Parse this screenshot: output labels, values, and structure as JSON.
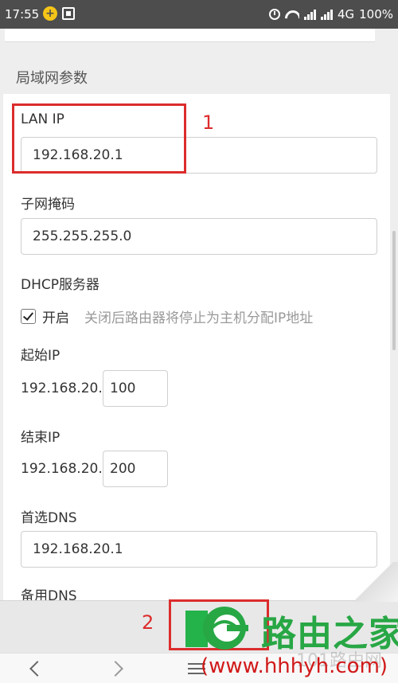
{
  "status_bar": {
    "time": "17:55",
    "network": "4G",
    "battery": "100%",
    "icons": [
      "app-plus-icon",
      "scan-icon",
      "alarm-icon",
      "wifi-icon",
      "signal-icon",
      "signal-icon",
      "battery-icon"
    ]
  },
  "lan": {
    "section_title": "局域网参数",
    "lan_ip_label": "LAN IP",
    "lan_ip_value": "192.168.20.1",
    "subnet_label": "子网掩码",
    "subnet_value": "255.255.255.0",
    "dhcp_label": "DHCP服务器",
    "dhcp_enable_label": "开启",
    "dhcp_enabled": true,
    "dhcp_hint": "关闭后路由器将停止为主机分配IP地址",
    "start_ip_label": "起始IP",
    "ip_prefix": "192.168.20.",
    "start_ip_value": "100",
    "end_ip_label": "结束IP",
    "end_ip_value": "200",
    "primary_dns_label": "首选DNS",
    "primary_dns_value": "192.168.20.1",
    "backup_dns_label": "备用DNS"
  },
  "annotations": {
    "step1": "1",
    "step2": "2"
  },
  "watermark": {
    "brand": "路由之家",
    "url": "(www.hhhyh.com)",
    "faint": "101路由网"
  },
  "colors": {
    "annotation_red": "#dc2c2c",
    "save_green": "#24b24a",
    "brand_green": "#28a745",
    "url_red": "#d11a1a"
  }
}
